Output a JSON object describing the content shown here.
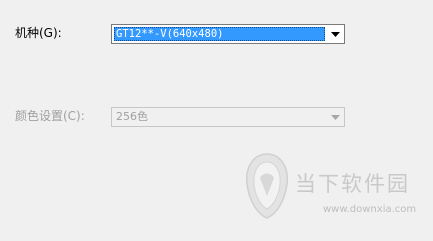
{
  "model_field": {
    "label": "机种(G):",
    "value": "GT12**-V(640x480)"
  },
  "color_field": {
    "label": "颜色设置(C):",
    "value": "256色"
  },
  "watermark": {
    "name": "当下软件园",
    "url": "www.downxia.com"
  },
  "icons": {
    "combo_arrow": "chevron-down-icon",
    "watermark_logo": "downxia-logo-icon"
  },
  "colors": {
    "selection": "#3399ff",
    "disabled_text": "#a0a0a0",
    "background": "#f0f0f0"
  }
}
